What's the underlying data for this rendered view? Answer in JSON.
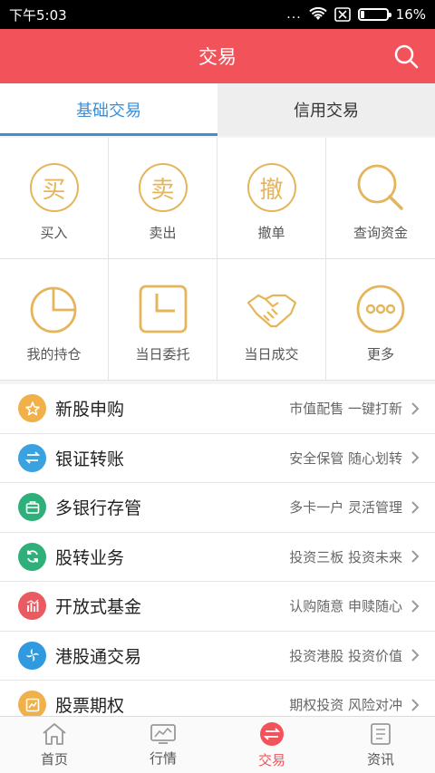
{
  "status": {
    "time": "下午5:03",
    "dots": "...",
    "battery": "16%",
    "battery_level": 0.16
  },
  "header": {
    "title": "交易"
  },
  "tabs": [
    {
      "label": "基础交易",
      "active": true
    },
    {
      "label": "信用交易",
      "active": false
    }
  ],
  "grid": [
    {
      "label": "买入",
      "icon_char": "买",
      "icon": "buy-icon"
    },
    {
      "label": "卖出",
      "icon_char": "卖",
      "icon": "sell-icon"
    },
    {
      "label": "撤单",
      "icon_char": "撤",
      "icon": "cancel-order-icon"
    },
    {
      "label": "查询资金",
      "icon": "search-funds-icon"
    },
    {
      "label": "我的持仓",
      "icon": "pie-chart-icon"
    },
    {
      "label": "当日委托",
      "icon": "clock-icon"
    },
    {
      "label": "当日成交",
      "icon": "handshake-icon"
    },
    {
      "label": "更多",
      "icon": "more-icon"
    }
  ],
  "list": [
    {
      "name": "新股申购",
      "sub": "市值配售 一键打新",
      "color": "#f0b14a",
      "icon": "star-icon"
    },
    {
      "name": "银证转账",
      "sub": "安全保管 随心划转",
      "color": "#3ba2e2",
      "icon": "transfer-icon"
    },
    {
      "name": "多银行存管",
      "sub": "多卡一户 灵活管理",
      "color": "#2fb07a",
      "icon": "briefcase-icon"
    },
    {
      "name": "股转业务",
      "sub": "投资三板 投资未来",
      "color": "#2fb07a",
      "icon": "refresh-icon"
    },
    {
      "name": "开放式基金",
      "sub": "认购随意 申赎随心",
      "color": "#ea5a61",
      "icon": "bar-chart-icon"
    },
    {
      "name": "港股通交易",
      "sub": "投资港股 投资价值",
      "color": "#2f9ae0",
      "icon": "bauhinia-icon"
    },
    {
      "name": "股票期权",
      "sub": "期权投资 风险对冲",
      "color": "#f0b14a",
      "icon": "chart-icon"
    }
  ],
  "nav": [
    {
      "label": "首页",
      "icon": "home-icon",
      "active": false
    },
    {
      "label": "行情",
      "icon": "market-icon",
      "active": false
    },
    {
      "label": "交易",
      "icon": "trade-icon",
      "active": true
    },
    {
      "label": "资讯",
      "icon": "news-icon",
      "active": false
    }
  ],
  "colors": {
    "brand": "#f2535a",
    "accent": "#3a8fd8",
    "gold": "#e5b55b"
  }
}
